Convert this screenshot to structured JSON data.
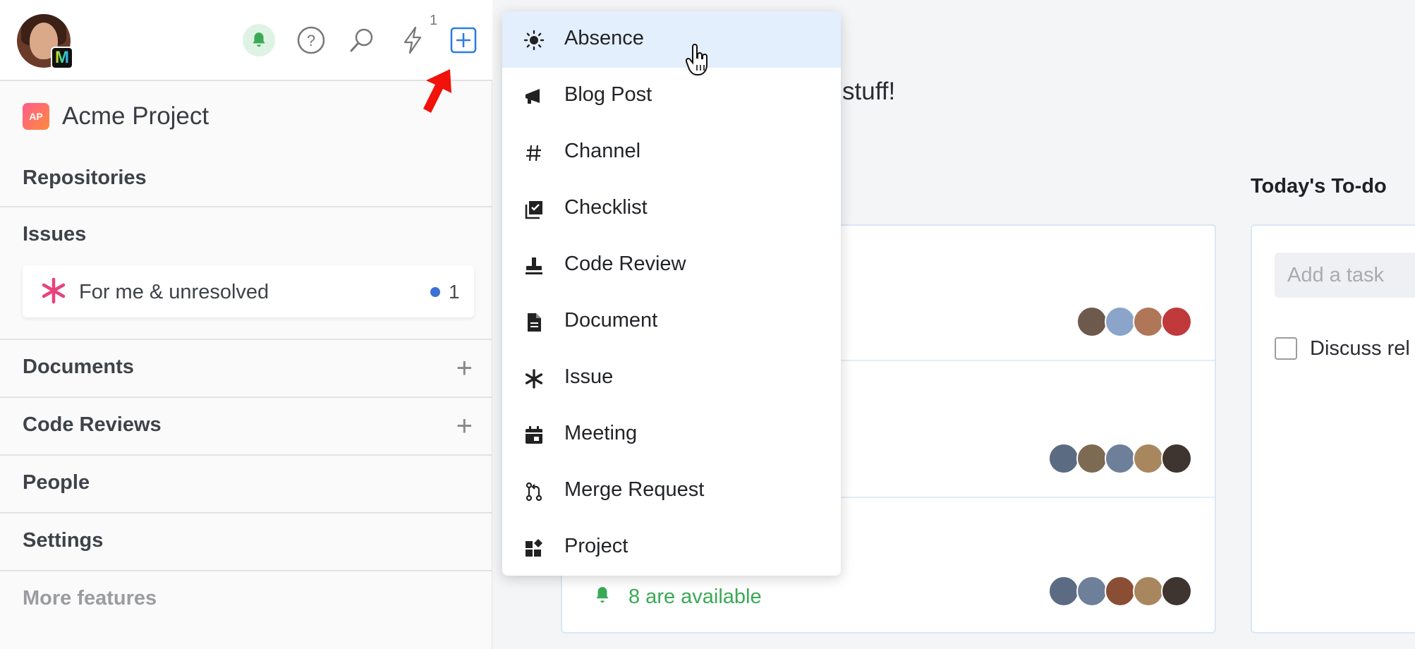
{
  "topbar": {
    "notifications_count": "1"
  },
  "project": {
    "logo_text": "AP",
    "name": "Acme Project"
  },
  "nav": {
    "repositories": "Repositories",
    "issues": "Issues",
    "issues_filter": {
      "label": "For me & unresolved",
      "count": "1"
    },
    "documents": "Documents",
    "code_reviews": "Code Reviews",
    "people": "People",
    "settings": "Settings",
    "more_features": "More features",
    "add_symbol": "+"
  },
  "main": {
    "greeting_fragment": "stuff!",
    "availability": "8 are available"
  },
  "todo": {
    "title": "Today's To-do",
    "input_placeholder": "Add a task",
    "tasks": [
      {
        "label": "Discuss rel",
        "checked": false
      }
    ]
  },
  "create_menu": {
    "items": [
      {
        "label": "Absence",
        "icon": "sun-icon",
        "active": true
      },
      {
        "label": "Blog Post",
        "icon": "megaphone-icon"
      },
      {
        "label": "Channel",
        "icon": "hash-icon"
      },
      {
        "label": "Checklist",
        "icon": "checklist-icon"
      },
      {
        "label": "Code Review",
        "icon": "stamp-icon"
      },
      {
        "label": "Document",
        "icon": "document-icon"
      },
      {
        "label": "Issue",
        "icon": "asterisk-icon"
      },
      {
        "label": "Meeting",
        "icon": "calendar-icon"
      },
      {
        "label": "Merge Request",
        "icon": "merge-request-icon"
      },
      {
        "label": "Project",
        "icon": "project-icon"
      }
    ]
  },
  "colors": {
    "accent": "#2f7de1",
    "success": "#3aa956",
    "issue_pink": "#e8427c",
    "menu_highlight": "#e4effd"
  }
}
